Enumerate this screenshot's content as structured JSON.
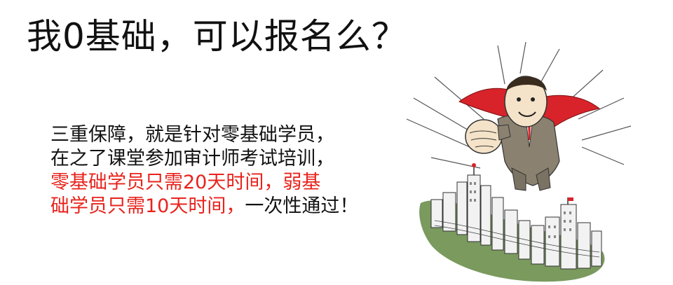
{
  "headline": "我0基础，可以报名么？",
  "body": {
    "line1": "三重保障，就是针对零基础学员，",
    "line2": "在之了课堂参加审计师考试培训，",
    "line3_red": "零基础学员只需20天时间，弱基",
    "line4_red": "础学员只需10天时间，",
    "line4_black": "一次性通过！"
  },
  "colors": {
    "text": "#111111",
    "highlight": "#e8231c",
    "cape": "#d8232a",
    "grass": "#7a9a5e",
    "suit": "#8a8170"
  },
  "illustration": {
    "icon": "flying-superhero-businessman-over-city"
  }
}
